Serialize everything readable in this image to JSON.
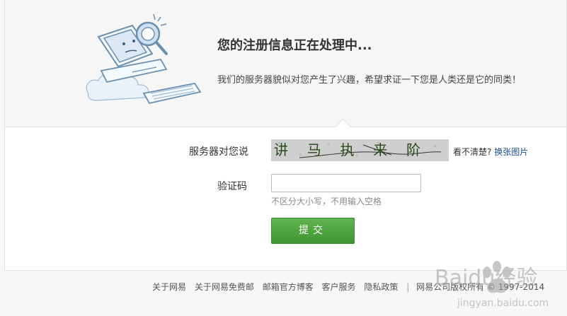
{
  "header": {
    "title": "您的注册信息正在处理中...",
    "subtitle": "我们的服务器貌似对您产生了兴趣，希望求证一下您是人类还是它的同类！"
  },
  "form": {
    "captcha_label": "服务器对您说",
    "captcha_text": "讲 马 执 来 阶",
    "captcha_hint_prefix": "看不清楚?",
    "captcha_refresh_link": "换张图片",
    "code_label": "验证码",
    "code_value": "",
    "code_hint": "不区分大小写，不用输入空格",
    "submit_label": "提交"
  },
  "footer": {
    "links": [
      "关于网易",
      "关于网易免费邮",
      "邮箱官方博客",
      "客户服务",
      "隐私政策"
    ],
    "separator": "|",
    "copyright": "网易公司版权所有 © 1997-2014"
  },
  "watermark": {
    "brand": "Baidu经验",
    "url": "jingyan.baidu.com"
  },
  "colors": {
    "accent_green": "#4aa43c",
    "link_blue": "#1a4d91",
    "band_bg": "#f6f6f6"
  },
  "icons": {
    "illustration": "computer-with-magnifier-illustration"
  }
}
